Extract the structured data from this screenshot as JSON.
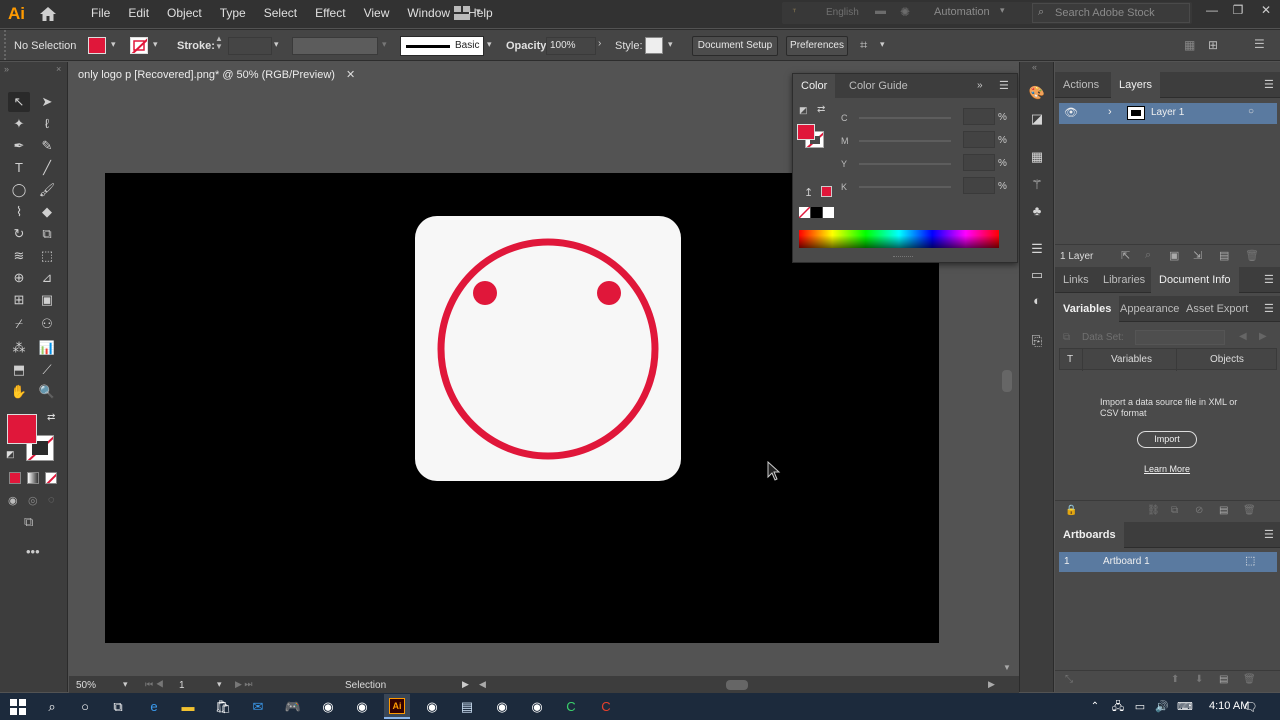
{
  "app": {
    "logo": "Ai",
    "menu": [
      "File",
      "Edit",
      "Object",
      "Type",
      "Select",
      "Effect",
      "View",
      "Window",
      "Help"
    ],
    "language": "English",
    "workspace": "Automation",
    "search_placeholder": "Search Adobe Stock"
  },
  "control_bar": {
    "selection": "No Selection",
    "stroke_label": "Stroke:",
    "brush": "Basic",
    "opacity_label": "Opacity:",
    "opacity_value": "100%",
    "style_label": "Style:",
    "document_setup": "Document Setup",
    "preferences": "Preferences"
  },
  "document": {
    "tab_title": "only logo p [Recovered].png* @ 50% (RGB/Preview)"
  },
  "status_bar": {
    "zoom": "50%",
    "artboard_num": "1",
    "tool": "Selection"
  },
  "color_panel": {
    "tabs": [
      "Color",
      "Color Guide"
    ],
    "channels": [
      "C",
      "M",
      "Y",
      "K"
    ],
    "unit": "%"
  },
  "layers_panel": {
    "tabs": [
      "Actions",
      "Layers"
    ],
    "layer_name": "Layer 1",
    "count": "1 Layer"
  },
  "mid_panel": {
    "tabs": [
      "Links",
      "Libraries",
      "Document Info"
    ]
  },
  "variables_panel": {
    "tabs": [
      "Variables",
      "Appearance",
      "Asset Export"
    ],
    "dataset_label": "Data Set:",
    "col_t": "T",
    "col_variables": "Variables",
    "col_objects": "Objects",
    "message": "Import a data source file in XML or CSV format",
    "import_button": "Import",
    "learn_more": "Learn More"
  },
  "artboards_panel": {
    "title": "Artboards",
    "row_num": "1",
    "row_name": "Artboard 1"
  },
  "taskbar": {
    "time": "4:10 AM"
  },
  "colors": {
    "accent_red": "#e0173a",
    "fill_swatch": "#e0173a",
    "logo_bg": "#f7f7f7",
    "artboard": "#000000"
  }
}
